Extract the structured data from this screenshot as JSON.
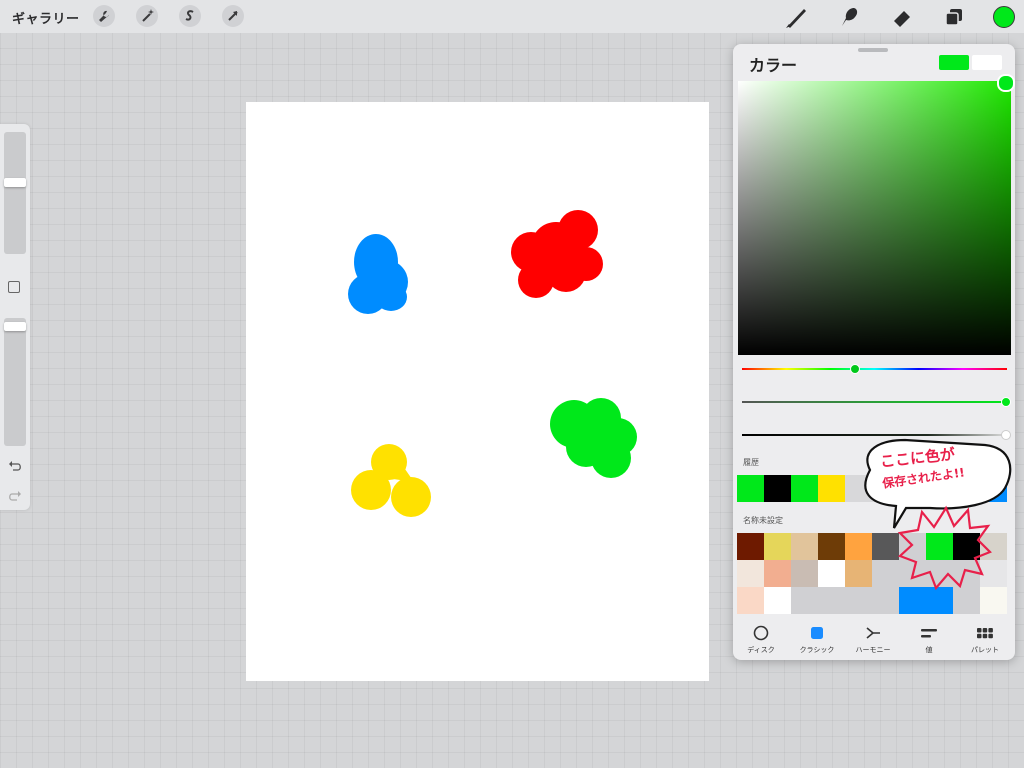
{
  "topbar": {
    "gallery_label": "ギャラリー",
    "left_tools": [
      "wrench-icon",
      "magic-wand-icon",
      "selection-s-icon",
      "transform-arrow-icon"
    ],
    "right_tools": [
      "brush-icon",
      "smudge-icon",
      "eraser-icon",
      "layers-icon"
    ],
    "current_color": "#00e81a"
  },
  "canvas": {
    "blobs": [
      {
        "name": "blue-blob",
        "color": "#008cff"
      },
      {
        "name": "red-blob",
        "color": "#ff0000"
      },
      {
        "name": "green-blob",
        "color": "#00e81a"
      },
      {
        "name": "yellow-blob",
        "color": "#ffe100"
      }
    ]
  },
  "color_panel": {
    "title": "カラー",
    "current_color": "#00e81a",
    "previous_color": "#ffffff",
    "history_label": "履歴",
    "history": [
      "#00e81a",
      "#000000",
      "#00e81a",
      "#ffe100",
      "#d8d8da",
      "#d8d8da",
      "#d8d8da",
      "#d8d8da",
      "#ff0000",
      "#008cff"
    ],
    "palette_label": "名称未設定",
    "palette": [
      [
        "#6e1a00",
        "#e5d65a",
        "#e1c49b",
        "#6e3c07",
        "#ffa33f",
        "#585859",
        "#d0d0d3",
        "#00e81a",
        "#000000",
        "#d7d3cb"
      ],
      [
        "#f2e6dc",
        "#f2ae90",
        "#c9bcb3",
        "#ffffff",
        "#e7b475",
        "#d0d0d3",
        "#d0d0d3",
        "#d0d0d3",
        "#d0d0d3",
        "#e6e6e8"
      ],
      [
        "#fad8c6",
        "#ffffff",
        "#d0d0d3",
        "#d0d0d3",
        "#d0d0d3",
        "#d0d0d3",
        "#008cff",
        "#008cff",
        "#d0d0d3",
        "#f9f8f1"
      ]
    ],
    "tabs": [
      {
        "label": "ディスク",
        "icon": "disc-icon"
      },
      {
        "label": "クラシック",
        "icon": "classic-square-icon"
      },
      {
        "label": "ハーモニー",
        "icon": "harmony-icon"
      },
      {
        "label": "値",
        "icon": "value-sliders-icon"
      },
      {
        "label": "パレット",
        "icon": "palette-grid-icon"
      }
    ],
    "active_tab": "クラシック"
  },
  "annotation": {
    "line1": "ここに色が",
    "line2": "保存されたよ!!",
    "color": "#e8204a"
  }
}
